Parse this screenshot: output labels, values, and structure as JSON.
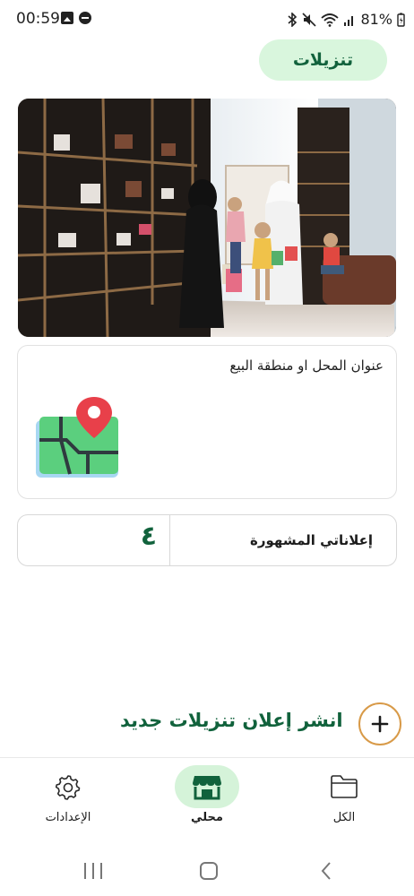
{
  "status_bar": {
    "time": "00:59",
    "battery": "81%",
    "icons": [
      "gallery-icon",
      "do-not-disturb-icon",
      "bluetooth-icon",
      "mute-icon",
      "wifi-icon",
      "signal-icon",
      "battery-charging-icon"
    ]
  },
  "header": {
    "sales_label": "تنزيلات"
  },
  "shop_photo": {
    "description_icon": "shop-photo"
  },
  "address_card": {
    "label": "عنوان المحل او منطقة البيع",
    "icon": "map-pin-icon"
  },
  "ads_card": {
    "label": "إعلاناتي المشهورة",
    "count": "٤"
  },
  "publish": {
    "label": "انشر إعلان تنزيلات جديد",
    "icon": "plus-icon"
  },
  "bottom_nav": {
    "items": [
      {
        "label": "الإعدادات",
        "icon": "gear-icon"
      },
      {
        "label": "محلي",
        "icon": "store-icon",
        "active": true
      },
      {
        "label": "الكل",
        "icon": "folder-icon"
      }
    ]
  },
  "colors": {
    "brand_green": "#11623c",
    "pill_green": "#d9f6dd",
    "accent_orange": "#d89a48"
  }
}
